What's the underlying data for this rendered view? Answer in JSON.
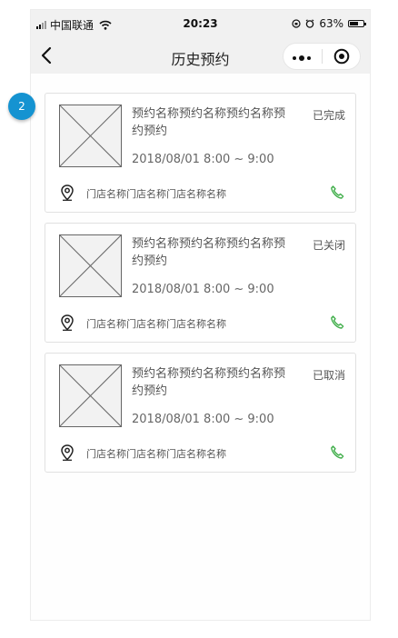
{
  "status_bar": {
    "carrier": "中国联通",
    "time": "20:23",
    "battery": "63%",
    "battery_level": 0.63
  },
  "navbar": {
    "title": "历史预约"
  },
  "annotation_badge": "2",
  "bookings": [
    {
      "title": "预约名称预约名称预约名称预约预约",
      "status": "已完成",
      "time_range": "2018/08/01 8:00 ~ 9:00",
      "store": "门店名称门店名称门店名称名称"
    },
    {
      "title": "预约名称预约名称预约名称预约预约",
      "status": "已关闭",
      "time_range": "2018/08/01 8:00 ~ 9:00",
      "store": "门店名称门店名称门店名称名称"
    },
    {
      "title": "预约名称预约名称预约名称预约预约",
      "status": "已取消",
      "time_range": "2018/08/01 8:00 ~ 9:00",
      "store": "门店名称门店名称门店名称名称"
    }
  ],
  "colors": {
    "accent_green": "#3fae49",
    "badge_blue": "#1593d1"
  }
}
